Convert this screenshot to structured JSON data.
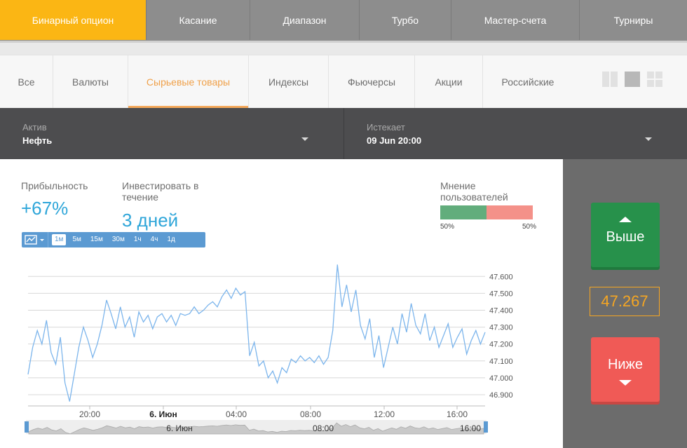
{
  "top_tabs": [
    "Бинарный опцион",
    "Касание",
    "Диапазон",
    "Турбо",
    "Мастер-счета",
    "Турниры"
  ],
  "categories": [
    "Все",
    "Валюты",
    "Сырьевые товары",
    "Индексы",
    "Фьючерсы",
    "Акции",
    "Российские"
  ],
  "active_category": "Сырьевые товары",
  "asset": {
    "label": "Актив",
    "value": "Нефть"
  },
  "expiry": {
    "label": "Истекает",
    "value": "09 Jun 20:00"
  },
  "profit": {
    "label": "Прибыльность",
    "value": "+67%"
  },
  "invest": {
    "label": "Инвестировать в течение",
    "value": "3 дней"
  },
  "opinion": {
    "label": "Мнение пользователей",
    "up_pct": "50%",
    "down_pct": "50%",
    "up_fraction": 0.5
  },
  "timeframes": [
    "1м",
    "5м",
    "15м",
    "30м",
    "1ч",
    "4ч",
    "1д"
  ],
  "active_timeframe": "1м",
  "buttons": {
    "up": "Выше",
    "down": "Ниже"
  },
  "current_price": "47.267",
  "colors": {
    "accent": "#fbb614",
    "up": "#27914b",
    "down": "#f05a56",
    "line": "#7cb5ec",
    "price": "#f5a623"
  },
  "chart_data": {
    "type": "line",
    "y_ticks": [
      "47.600",
      "47.500",
      "47.400",
      "47.300",
      "47.200",
      "47.100",
      "47.000",
      "46.900"
    ],
    "ylim": [
      46.85,
      47.68
    ],
    "x_ticks": [
      "20:00",
      "6. Июн",
      "04:00",
      "08:00",
      "12:00",
      "16:00"
    ],
    "navigator_labels": [
      "6. Июн",
      "08:00",
      "16:00"
    ],
    "series": [
      {
        "values": [
          47.02,
          47.18,
          47.28,
          47.2,
          47.34,
          47.15,
          47.08,
          47.24,
          46.97,
          46.86,
          47.02,
          47.18,
          47.3,
          47.22,
          47.12,
          47.2,
          47.31,
          47.46,
          47.38,
          47.29,
          47.42,
          47.3,
          47.36,
          47.24,
          47.39,
          47.33,
          47.37,
          47.29,
          47.36,
          47.38,
          47.33,
          47.37,
          47.31,
          47.38,
          47.37,
          47.38,
          47.42,
          47.38,
          47.4,
          47.43,
          47.45,
          47.42,
          47.48,
          47.52,
          47.47,
          47.53,
          47.49,
          47.51,
          47.13,
          47.21,
          47.07,
          47.1,
          47.0,
          47.04,
          46.97,
          47.06,
          47.03,
          47.11,
          47.09,
          47.13,
          47.1,
          47.12,
          47.09,
          47.13,
          47.08,
          47.12,
          47.28,
          47.67,
          47.42,
          47.55,
          47.39,
          47.52,
          47.31,
          47.23,
          47.35,
          47.12,
          47.25,
          47.06,
          47.18,
          47.3,
          47.2,
          47.38,
          47.27,
          47.44,
          47.31,
          47.26,
          47.38,
          47.22,
          47.3,
          47.18,
          47.25,
          47.32,
          47.18,
          47.24,
          47.29,
          47.14,
          47.22,
          47.28,
          47.2,
          47.27
        ]
      }
    ]
  }
}
